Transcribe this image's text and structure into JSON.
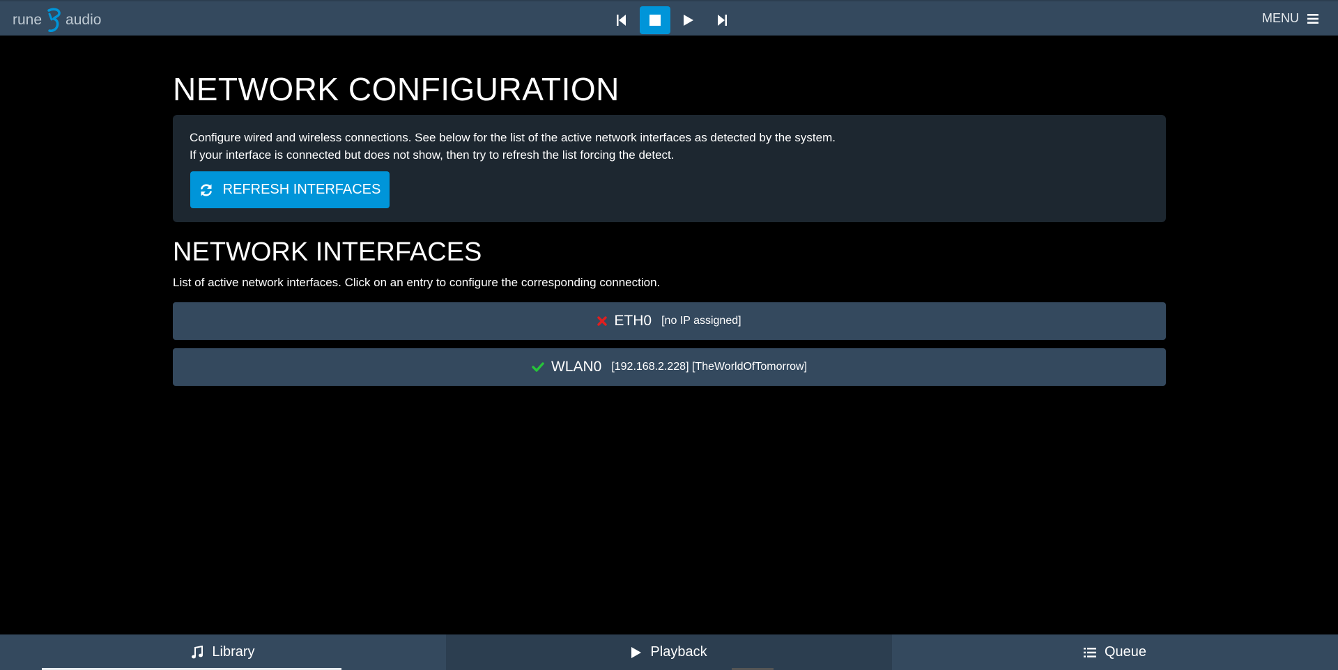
{
  "brand": {
    "word_left": "rune",
    "word_right": "audio"
  },
  "transport": {
    "buttons": [
      {
        "icon": "previous-icon"
      },
      {
        "icon": "stop-icon",
        "active": true
      },
      {
        "icon": "play-icon"
      },
      {
        "icon": "next-icon"
      }
    ]
  },
  "header": {
    "menu_label": "MENU"
  },
  "page": {
    "title": "NETWORK CONFIGURATION",
    "info_line_1": "Configure wired and wireless connections. See below for the list of the active network interfaces as detected by the system.",
    "info_line_2": "If your interface is connected but does not show, then try to refresh the list forcing the detect.",
    "refresh_label": "REFRESH INTERFACES"
  },
  "interfaces_section": {
    "title": "NETWORK INTERFACES",
    "lead": "List of active network interfaces. Click on an entry to configure the corresponding connection.",
    "items": [
      {
        "name": "ETH0",
        "meta": "[no IP assigned]",
        "status": "disconnected",
        "status_color": "#e01f1f"
      },
      {
        "name": "WLAN0",
        "meta": "[192.168.2.228] [TheWorldOfTomorrow]",
        "status": "connected",
        "status_color": "#27c33a"
      }
    ]
  },
  "bottom_nav": {
    "tabs": [
      {
        "label": "Library",
        "icon": "music-note-icon"
      },
      {
        "label": "Playback",
        "icon": "play-icon",
        "active": true
      },
      {
        "label": "Queue",
        "icon": "list-icon"
      }
    ]
  },
  "colors": {
    "topbar": "#34495e",
    "accent": "#0095d9",
    "panel": "#1d2730",
    "background": "#000000"
  }
}
